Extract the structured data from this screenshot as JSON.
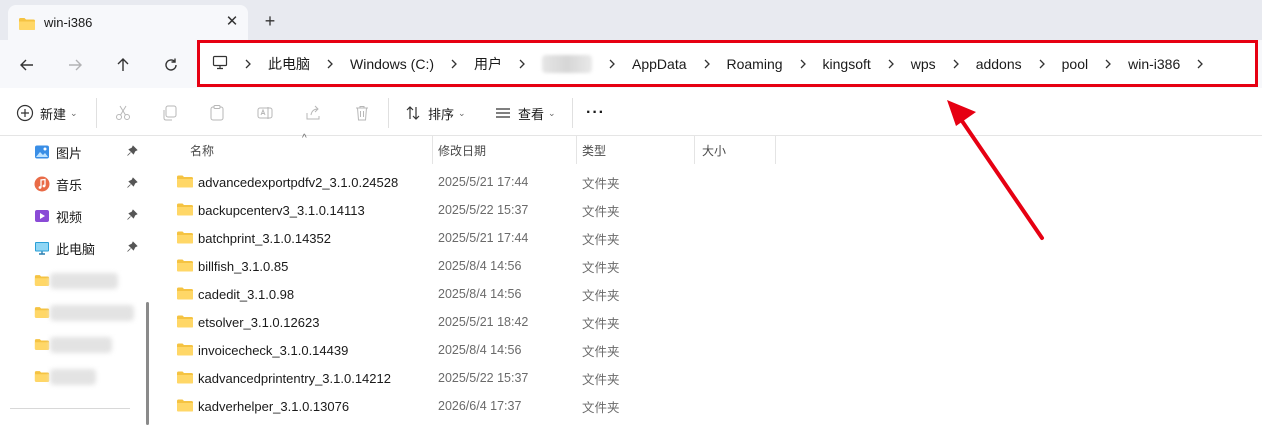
{
  "window": {
    "tab_title": "win-i386",
    "close_glyph": "✕",
    "new_tab_glyph": "+"
  },
  "nav": {
    "back_icon": "arrow-left-icon",
    "forward_icon": "arrow-right-icon",
    "up_icon": "arrow-up-icon",
    "refresh_icon": "refresh-icon"
  },
  "breadcrumb": {
    "root_icon": "computer-icon",
    "items": [
      "此电脑",
      "Windows (C:)",
      "用户",
      "",
      "AppData",
      "Roaming",
      "kingsoft",
      "wps",
      "addons",
      "pool",
      "win-i386"
    ]
  },
  "commands": {
    "new_label": "新建",
    "sort_label": "排序",
    "view_label": "查看",
    "more_glyph": "···"
  },
  "sidebar": {
    "items": [
      {
        "label": "图片",
        "icon": "pictures-icon"
      },
      {
        "label": "音乐",
        "icon": "music-icon"
      },
      {
        "label": "视频",
        "icon": "videos-icon"
      },
      {
        "label": "此电脑",
        "icon": "computer-icon"
      }
    ]
  },
  "columns": {
    "name": "名称",
    "modified": "修改日期",
    "type": "类型",
    "size": "大小"
  },
  "files": [
    {
      "name": "advancedexportpdfv2_3.1.0.24528",
      "modified": "2025/5/21 17:44",
      "type": "文件夹"
    },
    {
      "name": "backupcenterv3_3.1.0.14113",
      "modified": "2025/5/22 15:37",
      "type": "文件夹"
    },
    {
      "name": "batchprint_3.1.0.14352",
      "modified": "2025/5/21 17:44",
      "type": "文件夹"
    },
    {
      "name": "billfish_3.1.0.85",
      "modified": "2025/8/4 14:56",
      "type": "文件夹"
    },
    {
      "name": "cadedit_3.1.0.98",
      "modified": "2025/8/4 14:56",
      "type": "文件夹"
    },
    {
      "name": "etsolver_3.1.0.12623",
      "modified": "2025/5/21 18:42",
      "type": "文件夹"
    },
    {
      "name": "invoicecheck_3.1.0.14439",
      "modified": "2025/8/4 14:56",
      "type": "文件夹"
    },
    {
      "name": "kadvancedprintentry_3.1.0.14212",
      "modified": "2025/5/22 15:37",
      "type": "文件夹"
    },
    {
      "name": "kadverhelper_3.1.0.13076",
      "modified": "2026/6/4 17:37",
      "type": "文件夹"
    }
  ],
  "colors": {
    "highlight_border": "#e60012",
    "annotation_arrow": "#e60012",
    "folder_yellow": "#f5c342"
  }
}
